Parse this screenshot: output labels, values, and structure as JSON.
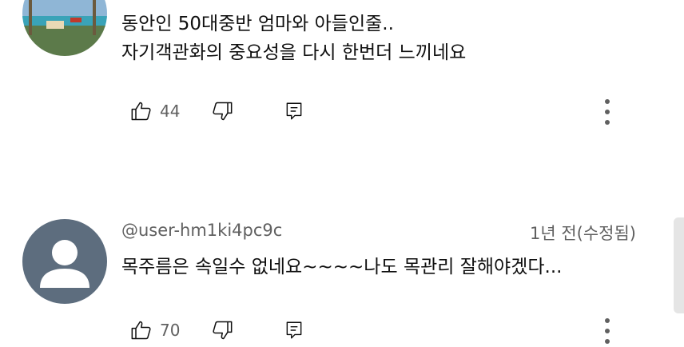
{
  "comments": [
    {
      "text_line1": "동안인 50대중반 엄마와 아들인줄..",
      "text_line2": "자기객관화의 중요성을 다시 한번더 느끼네요",
      "likes": "44",
      "avatar_icon": "beach-photo-avatar"
    },
    {
      "handle": "@user-hm1ki4pc9c",
      "time": "1년 전(수정됨)",
      "text_line1": "목주름은 속일수 없네요~~~~나도 목관리 잘해야겠다...",
      "likes": "70",
      "avatar_icon": "default-user-avatar"
    }
  ],
  "icons": {
    "like": "thumbs-up-icon",
    "dislike": "thumbs-down-icon",
    "reply": "reply-icon",
    "more": "more-vertical-icon"
  },
  "colors": {
    "text": "#0f0f0f",
    "secondary": "#606060",
    "default_avatar_bg": "#5d6d7e"
  }
}
